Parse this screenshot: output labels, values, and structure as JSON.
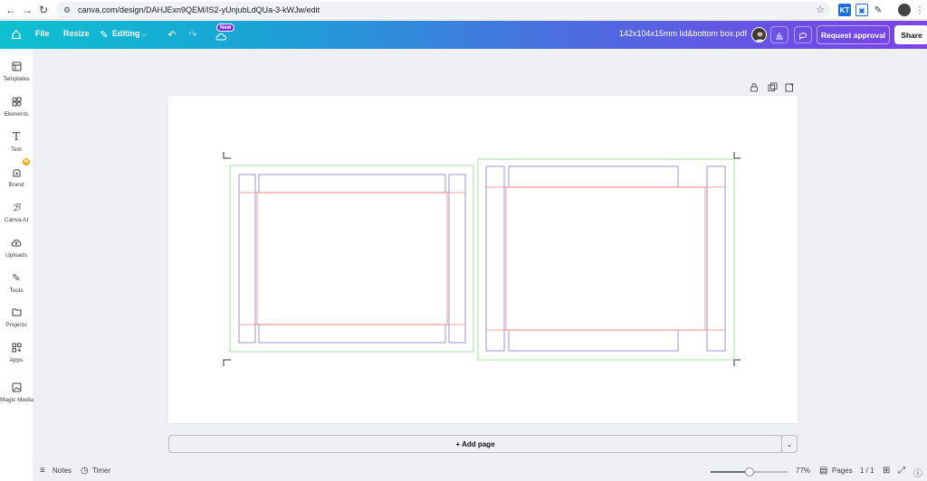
{
  "browser": {
    "url": "canva.com/design/DAHJExn9QEM/IS2-yUnjubLdQUa-3-kWJw/edit"
  },
  "header": {
    "file_label": "File",
    "resize_label": "Resize",
    "editing_label": "Editing",
    "new_badge": "New",
    "document_title": "142x104x15mm lid&bottom box.pdf",
    "request_approval_label": "Request approval",
    "share_label": "Share"
  },
  "sidebar": {
    "items": [
      {
        "label": "Templates",
        "icon": "templates-icon"
      },
      {
        "label": "Elements",
        "icon": "elements-icon"
      },
      {
        "label": "Text",
        "icon": "text-icon"
      },
      {
        "label": "Brand",
        "icon": "brand-icon"
      },
      {
        "label": "Canva AI",
        "icon": "canva-ai-icon"
      },
      {
        "label": "Uploads",
        "icon": "uploads-icon"
      },
      {
        "label": "Tools",
        "icon": "tools-icon"
      },
      {
        "label": "Projects",
        "icon": "projects-icon"
      },
      {
        "label": "Apps",
        "icon": "apps-icon"
      },
      {
        "label": "Magic Media",
        "icon": "magic-media-icon"
      }
    ],
    "brand_badge": "W"
  },
  "canvas": {
    "add_page_label": "+ Add page"
  },
  "footer": {
    "notes_label": "Notes",
    "timer_label": "Timer",
    "zoom_value": 0.5,
    "zoom_label": "77%",
    "pages_label": "Pages",
    "page_count": "1 / 1"
  },
  "colors": {
    "header_start": "#0ec0d0",
    "header_end": "#7b43e6",
    "cut_line": "#7f7fc8",
    "fold_line": "#f08080",
    "bleed_line": "#8fd88f"
  }
}
